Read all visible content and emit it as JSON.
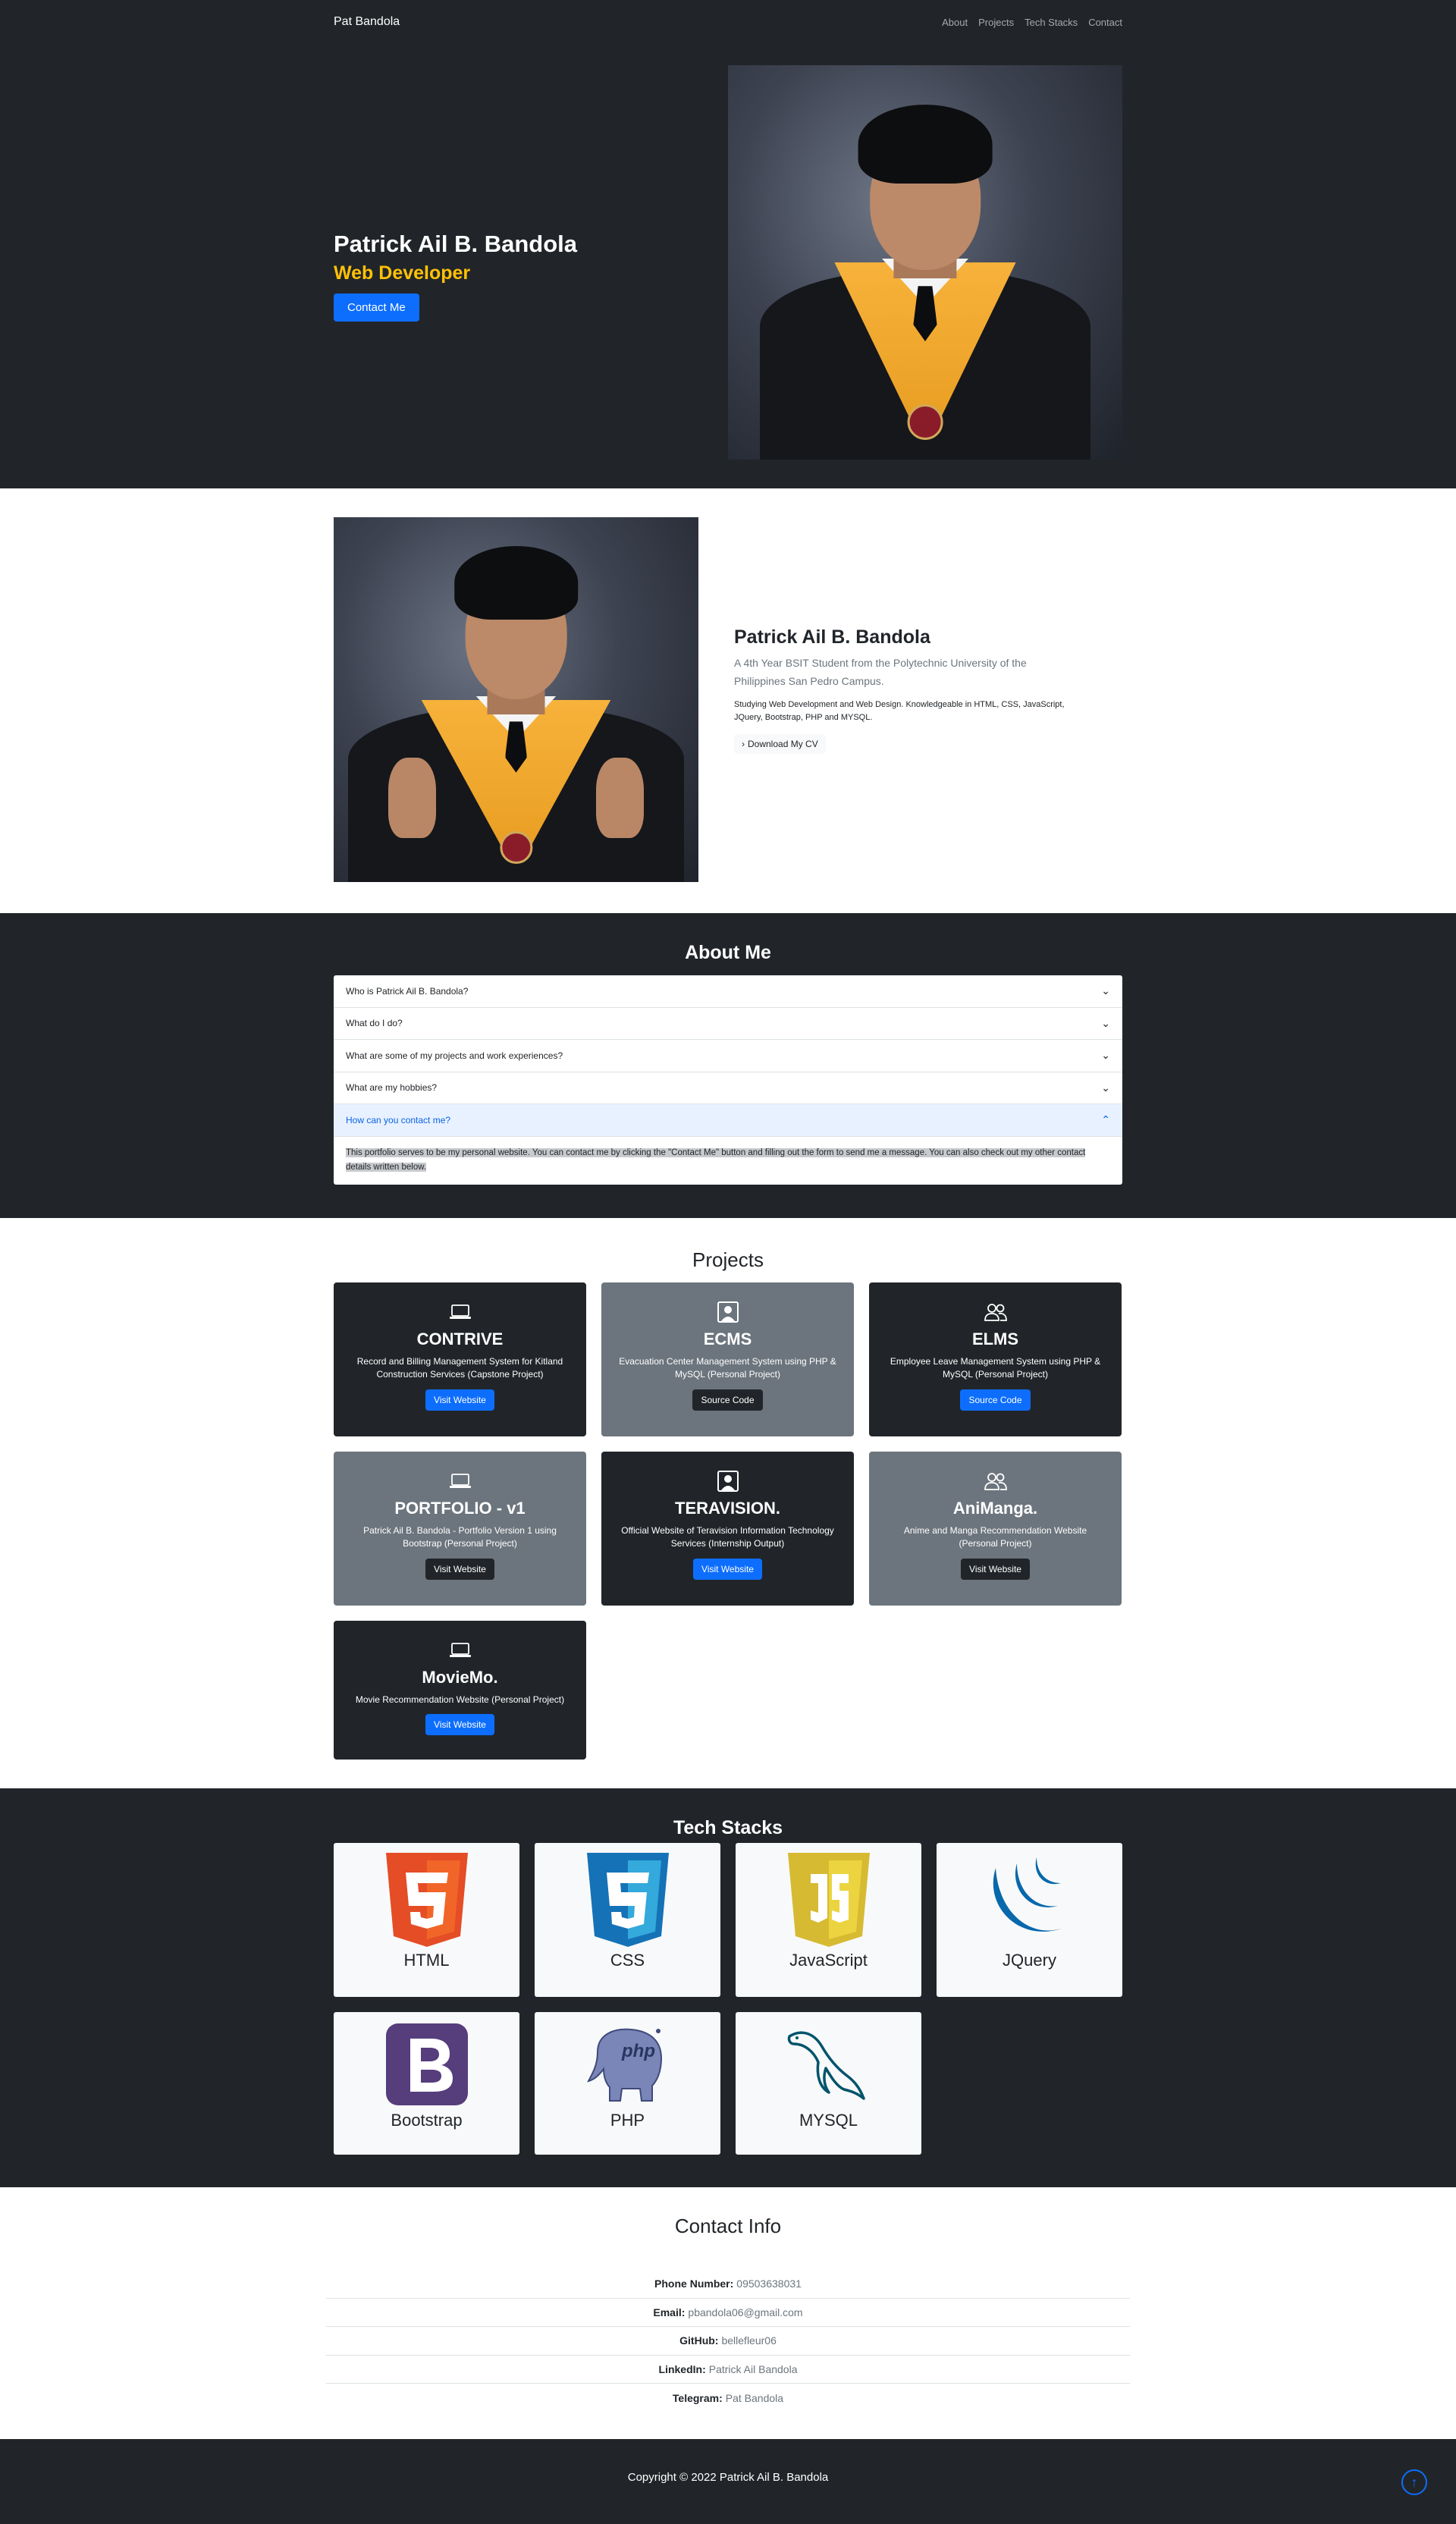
{
  "navbar": {
    "brand": "Pat Bandola",
    "links": [
      "About",
      "Projects",
      "Tech Stacks",
      "Contact"
    ]
  },
  "hero": {
    "name": "Patrick Ail B. Bandola",
    "role": "Web Developer",
    "cta": "Contact Me"
  },
  "intro": {
    "name": "Patrick Ail B. Bandola",
    "lead": "A 4th Year BSIT Student from the Polytechnic University of the Philippines San Pedro Campus.",
    "body": "Studying Web Development and Web Design. Knowledgeable in HTML, CSS, JavaScript, JQuery, Bootstrap, PHP and MYSQL.",
    "cv_button": "Download My CV"
  },
  "about": {
    "title": "About Me",
    "items": [
      "Who is Patrick Ail B. Bandola?",
      "What do I do?",
      "What are some of my projects and work experiences?",
      "What are my hobbies?",
      "How can you contact me?"
    ],
    "open_body": "This portfolio serves to be my personal website. You can contact me by clicking the \"Contact Me\" button and filling out the form to send me a message. You can also check out my other contact details written below."
  },
  "projects": {
    "title": "Projects",
    "cards": [
      {
        "title": "CONTRIVE",
        "desc": "Record and Billing Management System for Kitland Construction Services (Capstone Project)",
        "button": "Visit Website",
        "icon": "laptop-icon"
      },
      {
        "title": "ECMS",
        "desc": "Evacuation Center Management System using PHP & MySQL (Personal Project)",
        "button": "Source Code",
        "icon": "person-badge-icon"
      },
      {
        "title": "ELMS",
        "desc": "Employee Leave Management System using PHP & MySQL (Personal Project)",
        "button": "Source Code",
        "icon": "people-icon"
      },
      {
        "title": "PORTFOLIO - v1",
        "desc": "Patrick Ail B. Bandola - Portfolio Version 1 using Bootstrap (Personal Project)",
        "button": "Visit Website",
        "icon": "laptop-icon"
      },
      {
        "title": "TERAVISION.",
        "desc": "Official Website of Teravision Information Technology Services (Internship Output)",
        "button": "Visit Website",
        "icon": "person-badge-icon"
      },
      {
        "title": "AniManga.",
        "desc": "Anime and Manga Recommendation Website (Personal Project)",
        "button": "Visit Website",
        "icon": "people-icon"
      },
      {
        "title": "MovieMo.",
        "desc": "Movie Recommendation Website (Personal Project)",
        "button": "Visit Website",
        "icon": "laptop-icon"
      }
    ]
  },
  "tech": {
    "title": "Tech Stacks",
    "items": [
      "HTML",
      "CSS",
      "JavaScript",
      "JQuery",
      "Bootstrap",
      "PHP",
      "MYSQL"
    ]
  },
  "contact": {
    "title": "Contact Info",
    "rows": [
      {
        "label": "Phone Number:",
        "value": "09503638031"
      },
      {
        "label": "Email:",
        "value": "pbandola06@gmail.com"
      },
      {
        "label": "GitHub:",
        "value": "bellefleur06"
      },
      {
        "label": "LinkedIn:",
        "value": "Patrick Ail Bandola"
      },
      {
        "label": "Telegram:",
        "value": "Pat Bandola"
      }
    ]
  },
  "footer": {
    "copyright": "Copyright © 2022 Patrick Ail B. Bandola"
  },
  "colors": {
    "dark": "#212529",
    "accent": "#ffc107",
    "primary": "#0d6efd",
    "gray": "#6c757d"
  }
}
